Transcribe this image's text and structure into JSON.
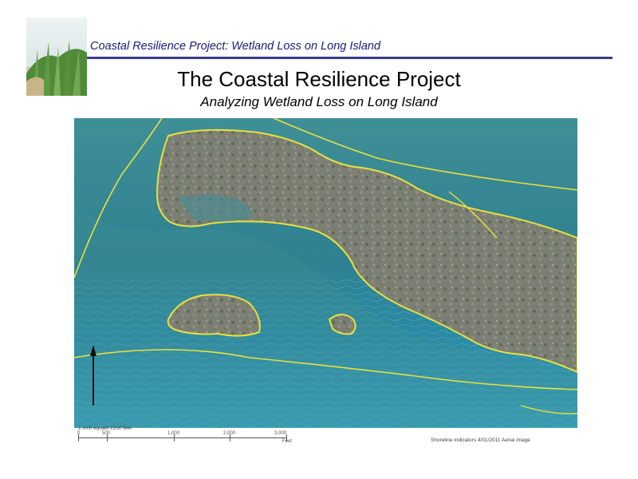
{
  "header": {
    "running_title": "Coastal Resilience Project: Wetland Loss on Long Island",
    "title": "The Coastal Resilience Project",
    "subtitle": "Analyzing Wetland Loss on Long Island"
  },
  "map": {
    "scale_caption": "1 inch equals 2250 feet",
    "scale_ticks": [
      "0",
      "500",
      "1,000",
      "2,000",
      "3,000"
    ],
    "scale_unit": "Feet",
    "source_caption": "Shoreline indicators 4/01/2011 Aerial image"
  },
  "colors": {
    "header_text": "#1a1a7a",
    "rule": "#3a3a8a",
    "shoreline": "#e8e23a",
    "water": "#2a8aa0"
  }
}
